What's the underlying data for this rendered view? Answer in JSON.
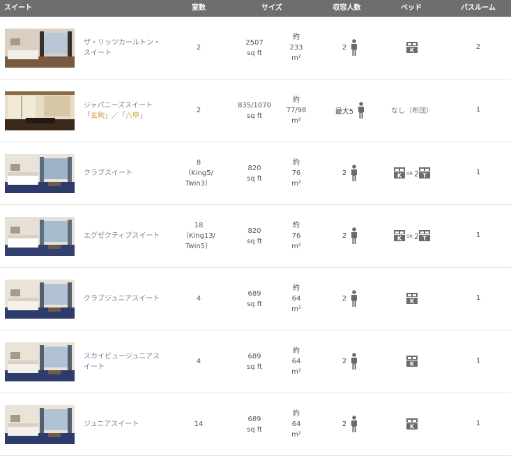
{
  "header": {
    "suite": "スイート",
    "rooms": "室数",
    "size": "サイズ",
    "capacity": "収容人数",
    "bed": "ベッド",
    "bathroom": "バスルーム"
  },
  "icons": {
    "person": "person-icon",
    "king_bed": "king-bed-icon",
    "twin_bed": "twin-bed-icon"
  },
  "bed_labels": {
    "king": "K",
    "twin": "T",
    "or": "OR"
  },
  "colors": {
    "header_bg": "#6e6e6e",
    "suite_name": "#7d7d9b",
    "highlight": "#d4a24c",
    "icon": "#6b6b6b"
  },
  "rows": [
    {
      "name_lines": [
        "ザ・リッツカールトン・",
        "スイート"
      ],
      "rooms_lines": [
        "2"
      ],
      "sqft_lines": [
        "2507",
        "sq ft"
      ],
      "sqm_lines": [
        "約",
        "233",
        "m²"
      ],
      "capacity": "2",
      "bed_type": "king",
      "bath": "2"
    },
    {
      "name_lines": [
        "ジャパニーズスイート",
        "「",
        "玄駒",
        "」／「",
        "六甲",
        "」"
      ],
      "rooms_lines": [
        "2"
      ],
      "sqft_lines": [
        "835/1070",
        "sq ft"
      ],
      "sqm_lines": [
        "約",
        "77/98",
        "m²"
      ],
      "capacity": "最大5",
      "bed_type": "none",
      "bed_text": "なし（布団）",
      "bath": "1"
    },
    {
      "name_lines": [
        "クラブスイート"
      ],
      "rooms_lines": [
        "8",
        "（King5/",
        "Twin3）"
      ],
      "sqft_lines": [
        "820",
        "sq ft"
      ],
      "sqm_lines": [
        "約",
        "76",
        "m²"
      ],
      "capacity": "2",
      "bed_type": "king_or_twin",
      "bed_twin_count": "2",
      "bath": "1"
    },
    {
      "name_lines": [
        "エグゼクティブスイート"
      ],
      "rooms_lines": [
        "18",
        "（King13/",
        "Twin5）"
      ],
      "sqft_lines": [
        "820",
        "sq ft"
      ],
      "sqm_lines": [
        "約",
        "76",
        "m²"
      ],
      "capacity": "2",
      "bed_type": "king_or_twin",
      "bed_twin_count": "2",
      "bath": "1"
    },
    {
      "name_lines": [
        "クラブジュニアスイート"
      ],
      "rooms_lines": [
        "4"
      ],
      "sqft_lines": [
        "689",
        "sq ft"
      ],
      "sqm_lines": [
        "約",
        "64",
        "m²"
      ],
      "capacity": "2",
      "bed_type": "king",
      "bath": "1"
    },
    {
      "name_lines": [
        "スカイビュージュニアス",
        "イート"
      ],
      "rooms_lines": [
        "4"
      ],
      "sqft_lines": [
        "689",
        "sq ft"
      ],
      "sqm_lines": [
        "約",
        "64",
        "m²"
      ],
      "capacity": "2",
      "bed_type": "king",
      "bath": "1"
    },
    {
      "name_lines": [
        "ジュニアスイート"
      ],
      "rooms_lines": [
        "14"
      ],
      "sqft_lines": [
        "689",
        "sq ft"
      ],
      "sqm_lines": [
        "約",
        "64",
        "m²"
      ],
      "capacity": "2",
      "bed_type": "king",
      "bath": "1"
    }
  ]
}
